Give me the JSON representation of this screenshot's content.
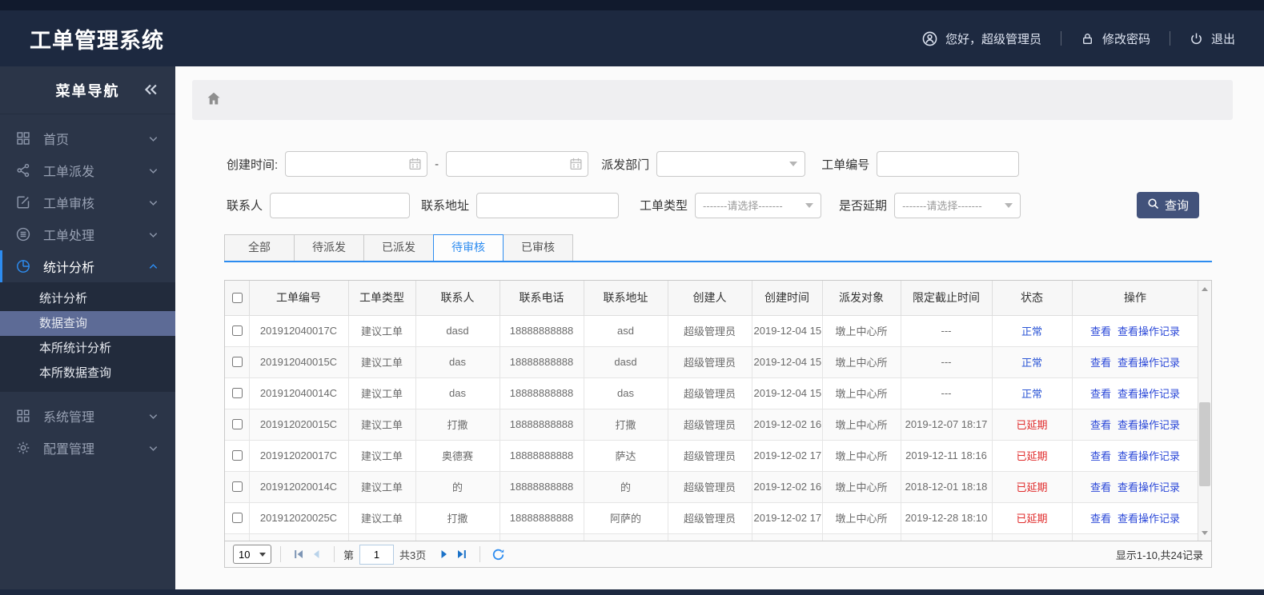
{
  "app": {
    "title": "工单管理系统"
  },
  "header": {
    "greeting": "您好，超级管理员",
    "change_password": "修改密码",
    "logout": "退出"
  },
  "sidebar": {
    "title": "菜单导航",
    "items": [
      {
        "id": "home",
        "label": "首页",
        "icon": "grid"
      },
      {
        "id": "dispatch",
        "label": "工单派发",
        "icon": "share"
      },
      {
        "id": "review",
        "label": "工单审核",
        "icon": "edit"
      },
      {
        "id": "process",
        "label": "工单处理",
        "icon": "stack"
      },
      {
        "id": "stats",
        "label": "统计分析",
        "icon": "pie",
        "active": true,
        "children": [
          "统计分析",
          "数据查询",
          "本所统计分析",
          "本所数据查询"
        ],
        "selected_child": "数据查询"
      },
      {
        "id": "system",
        "label": "系统管理",
        "icon": "modules"
      },
      {
        "id": "config",
        "label": "配置管理",
        "icon": "gear"
      }
    ]
  },
  "filters": {
    "create_time_label": "创建时间:",
    "range_separator": "-",
    "dispatch_dept_label": "派发部门",
    "order_no_label": "工单编号",
    "contact_label": "联系人",
    "address_label": "联系地址",
    "order_type_label": "工单类型",
    "order_type_placeholder": "-------请选择-------",
    "delay_label": "是否延期",
    "delay_placeholder": "-------请选择-------",
    "search_button": "查询"
  },
  "tabs": [
    {
      "label": "全部",
      "active": false
    },
    {
      "label": "待派发",
      "active": false
    },
    {
      "label": "已派发",
      "active": false
    },
    {
      "label": "待审核",
      "active": true
    },
    {
      "label": "已审核",
      "active": false
    }
  ],
  "table": {
    "columns": [
      "工单编号",
      "工单类型",
      "联系人",
      "联系电话",
      "联系地址",
      "创建人",
      "创建时间",
      "派发对象",
      "限定截止时间",
      "状态",
      "操作"
    ],
    "action_labels": {
      "view": "查看",
      "view_log": "查看操作记录"
    },
    "rows": [
      {
        "order_no": "201912040017C",
        "type": "建议工单",
        "contact": "dasd",
        "phone": "18888888888",
        "address": "asd",
        "creator": "超级管理员",
        "created": "2019-12-04 15",
        "target": "墩上中心所",
        "deadline": "---",
        "status": "正常",
        "status_type": "normal"
      },
      {
        "order_no": "201912040015C",
        "type": "建议工单",
        "contact": "das",
        "phone": "18888888888",
        "address": "dasd",
        "creator": "超级管理员",
        "created": "2019-12-04 15",
        "target": "墩上中心所",
        "deadline": "---",
        "status": "正常",
        "status_type": "normal"
      },
      {
        "order_no": "201912040014C",
        "type": "建议工单",
        "contact": "das",
        "phone": "18888888888",
        "address": "das",
        "creator": "超级管理员",
        "created": "2019-12-04 15",
        "target": "墩上中心所",
        "deadline": "---",
        "status": "正常",
        "status_type": "normal"
      },
      {
        "order_no": "201912020015C",
        "type": "建议工单",
        "contact": "打撒",
        "phone": "18888888888",
        "address": "打撒",
        "creator": "超级管理员",
        "created": "2019-12-02 16",
        "target": "墩上中心所",
        "deadline": "2019-12-07 18:17",
        "status": "已延期",
        "status_type": "delayed"
      },
      {
        "order_no": "201912020017C",
        "type": "建议工单",
        "contact": "奥德赛",
        "phone": "18888888888",
        "address": "萨达",
        "creator": "超级管理员",
        "created": "2019-12-02 17",
        "target": "墩上中心所",
        "deadline": "2019-12-11 18:16",
        "status": "已延期",
        "status_type": "delayed"
      },
      {
        "order_no": "201912020014C",
        "type": "建议工单",
        "contact": "的",
        "phone": "18888888888",
        "address": "的",
        "creator": "超级管理员",
        "created": "2019-12-02 16",
        "target": "墩上中心所",
        "deadline": "2018-12-01 18:18",
        "status": "已延期",
        "status_type": "delayed"
      },
      {
        "order_no": "201912020025C",
        "type": "建议工单",
        "contact": "打撒",
        "phone": "18888888888",
        "address": "阿萨的",
        "creator": "超级管理员",
        "created": "2019-12-02 17",
        "target": "墩上中心所",
        "deadline": "2019-12-28 18:10",
        "status": "已延期",
        "status_type": "delayed"
      }
    ]
  },
  "pagination": {
    "page_size": "10",
    "page_prefix": "第",
    "current_page": "1",
    "total_pages": "共3页",
    "summary": "显示1-10,共24记录"
  },
  "colors": {
    "accent": "#2d8cf0",
    "header_bg": "#1d2940",
    "sidebar_bg": "#2b3548",
    "submenu_selected_bg": "#5d6b96",
    "button_bg": "#42527b",
    "status_normal": "#2b55d5",
    "status_delayed": "#e02b2b",
    "link": "#2b48d8"
  }
}
